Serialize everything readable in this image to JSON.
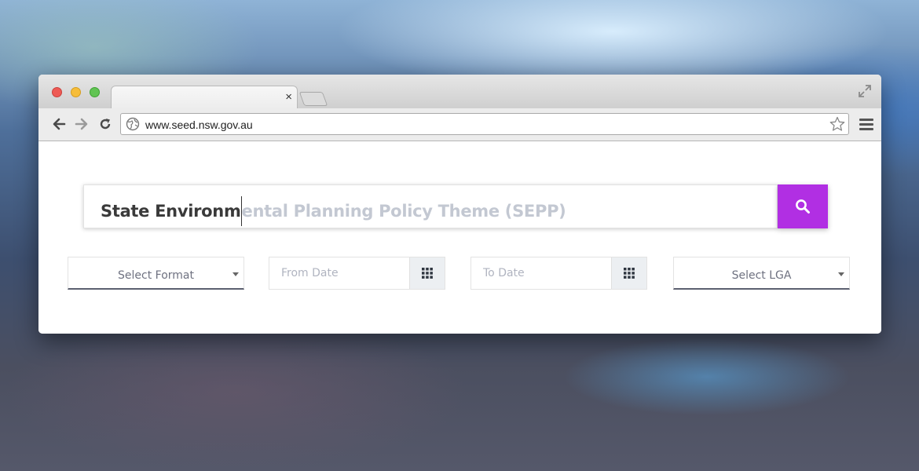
{
  "browser": {
    "url": "www.seed.nsw.gov.au",
    "tab_close": "×"
  },
  "search": {
    "typed": "State Environm",
    "suggestion": "ental Planning Policy Theme (SEPP)",
    "button_icon": "search-icon",
    "button_color": "#b12fe3"
  },
  "filters": {
    "format_placeholder": "Select Format",
    "from_date_placeholder": "From Date",
    "to_date_placeholder": "To Date",
    "lga_placeholder": "Select LGA",
    "calendar_icon": "grid-calendar-icon"
  }
}
